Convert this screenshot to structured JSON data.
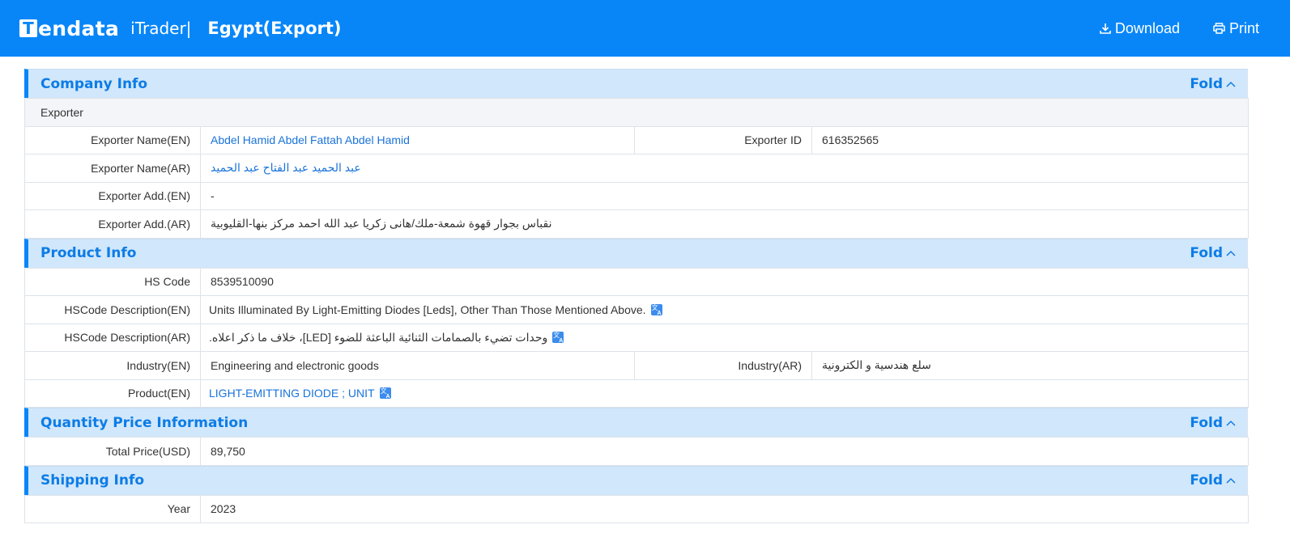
{
  "header": {
    "logo_t": "T",
    "logo_rest": "endata",
    "product": "iTrader|",
    "title": "Egypt(Export)",
    "download_label": "Download",
    "print_label": "Print"
  },
  "fold_label": "Fold",
  "company": {
    "title": "Company Info",
    "subhead": "Exporter",
    "name_en_label": "Exporter Name(EN)",
    "name_en": "Abdel Hamid Abdel Fattah Abdel Hamid",
    "id_label": "Exporter ID",
    "id": "616352565",
    "name_ar_label": "Exporter Name(AR)",
    "name_ar": "عبد الحميد عبد الفتاح عبد الحميد",
    "add_en_label": "Exporter Add.(EN)",
    "add_en": "-",
    "add_ar_label": "Exporter Add.(AR)",
    "add_ar": "نقباس بجوار قهوة شمعة-ملك/هانى زكريا عبد الله احمد مركز بنها-القليوبية"
  },
  "product": {
    "title": "Product Info",
    "hs_label": "HS Code",
    "hs": "8539510090",
    "desc_en_label": "HSCode Description(EN)",
    "desc_en": "Units Illuminated By Light-Emitting Diodes [Leds], Other Than Those Mentioned Above.",
    "desc_ar_label": "HSCode Description(AR)",
    "desc_ar": "وحدات تضيء بالصمامات الثنائية الباعثة للضوء [LED]، خلاف ما ذكر اعلاه.",
    "industry_en_label": "Industry(EN)",
    "industry_en": "Engineering and electronic goods",
    "industry_ar_label": "Industry(AR)",
    "industry_ar": "سلع هندسية و الكترونية",
    "product_en_label": "Product(EN)",
    "product_en": "LIGHT-EMITTING DIODE ; UNIT"
  },
  "quantity": {
    "title": "Quantity Price Information",
    "total_label": "Total Price(USD)",
    "total": "89,750"
  },
  "shipping": {
    "title": "Shipping Info",
    "year_label": "Year",
    "year": "2023"
  },
  "colors": {
    "brand": "#0886f8",
    "section_bg": "#d1e7fb",
    "link": "#1a73d9"
  }
}
